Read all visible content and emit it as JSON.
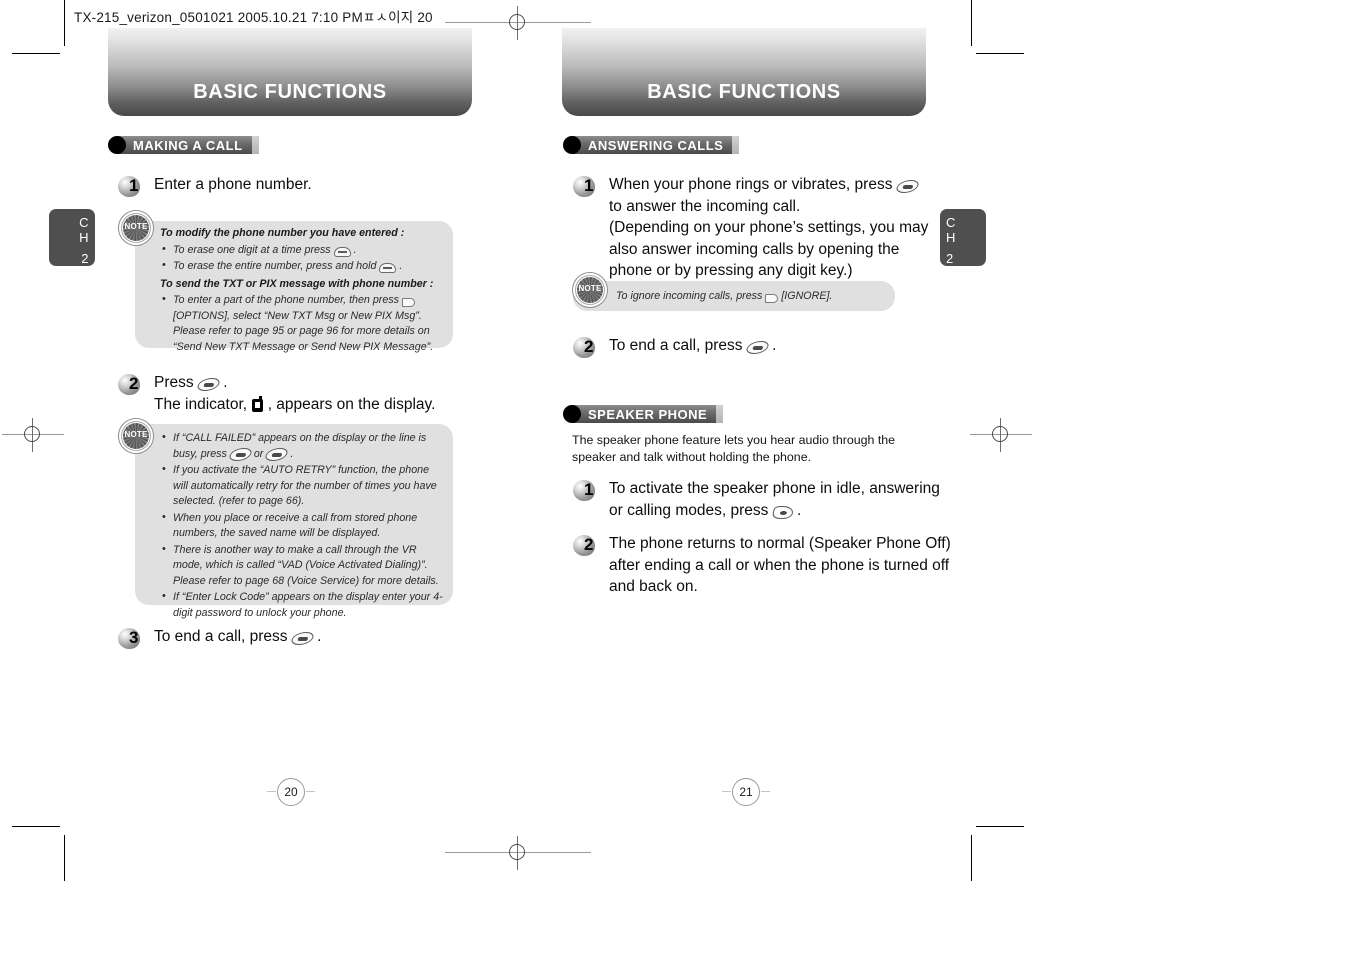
{
  "slug": "TX-215_verizon_0501021  2005.10.21 7:10 PMㅍㅅ이지 20",
  "banners": {
    "left": "BASIC FUNCTIONS",
    "right": "BASIC FUNCTIONS"
  },
  "chapter_tabs": {
    "left": {
      "c": "C",
      "h": "H",
      "num": "2"
    },
    "right": {
      "c": "C",
      "h": "H",
      "num": "2"
    }
  },
  "left_page": {
    "page_number": "20",
    "section": {
      "title": "MAKING A CALL"
    },
    "steps": [
      {
        "num": "1",
        "text": "Enter a phone number."
      },
      {
        "num": "2",
        "line1_pre": "Press",
        "line1_post": ".",
        "line2_pre": "The indicator,",
        "line2_post": ", appears on the display."
      },
      {
        "num": "3",
        "pre": "To end a call, press",
        "post": "."
      }
    ],
    "note1": {
      "title1": "To modify the phone number you have entered :",
      "bullet1_pre": "To erase one digit at a time press",
      "bullet1_post": ".",
      "bullet2_pre": "To erase the entire number, press and hold",
      "bullet2_post": ".",
      "title2": "To send the TXT or PIX message with phone number :",
      "bullet3_pre": "To enter a part of the phone number, then press",
      "bullet3_post": "[OPTIONS], select “New TXT Msg or New PIX Msg”. Please refer to page 95 or page 96 for more details on “Send New TXT Message or Send New PIX Message”."
    },
    "note2": {
      "b1_pre": "If “CALL FAILED” appears on the display or the line is busy, press",
      "b1_mid": "or",
      "b1_post": ".",
      "b2": "If you activate the “AUTO RETRY” function, the phone will automatically retry for the number of times you have selected. (refer to page 66).",
      "b3": "When you place or receive a call from stored phone numbers, the saved name will be displayed.",
      "b4": "There is another way to make a call through the VR mode, which is called “VAD (Voice Activated Dialing)”. Please refer to page 68 (Voice Service) for more details.",
      "b5": "If “Enter Lock Code” appears on the display enter your 4-digit password to unlock your phone."
    }
  },
  "right_page": {
    "page_number": "21",
    "section1": {
      "title": "ANSWERING CALLS"
    },
    "section2": {
      "title": "SPEAKER PHONE"
    },
    "answering_steps": [
      {
        "num": "1",
        "line1_pre": "When your phone rings or vibrates, press",
        "line2": "to answer the incoming call.",
        "line3": "(Depending on your phone’s settings, you may",
        "line4": "also answer incoming calls by opening the",
        "line5": "phone or by pressing any digit key.)"
      },
      {
        "num": "2",
        "pre": "To end a call, press",
        "post": "."
      }
    ],
    "note3": {
      "pre": "To ignore incoming calls, press",
      "post": "[IGNORE]."
    },
    "speaker_intro": "The speaker phone feature lets you hear audio through the speaker and talk without holding the phone.",
    "speaker_steps": [
      {
        "num": "1",
        "line1": "To activate the speaker phone in idle, answering",
        "line2_pre": "or calling modes, press",
        "line2_post": "."
      },
      {
        "num": "2",
        "line1": "The phone returns to normal (Speaker Phone Off)",
        "line2": "after ending a call or when the phone is turned off",
        "line3": "and back on."
      }
    ]
  },
  "note_icon_label": "NOTE",
  "colors": {
    "banner_dark": "#4a4a4a",
    "note_bg": "#e0e0e0",
    "tab_bg": "#4f4f4f"
  }
}
